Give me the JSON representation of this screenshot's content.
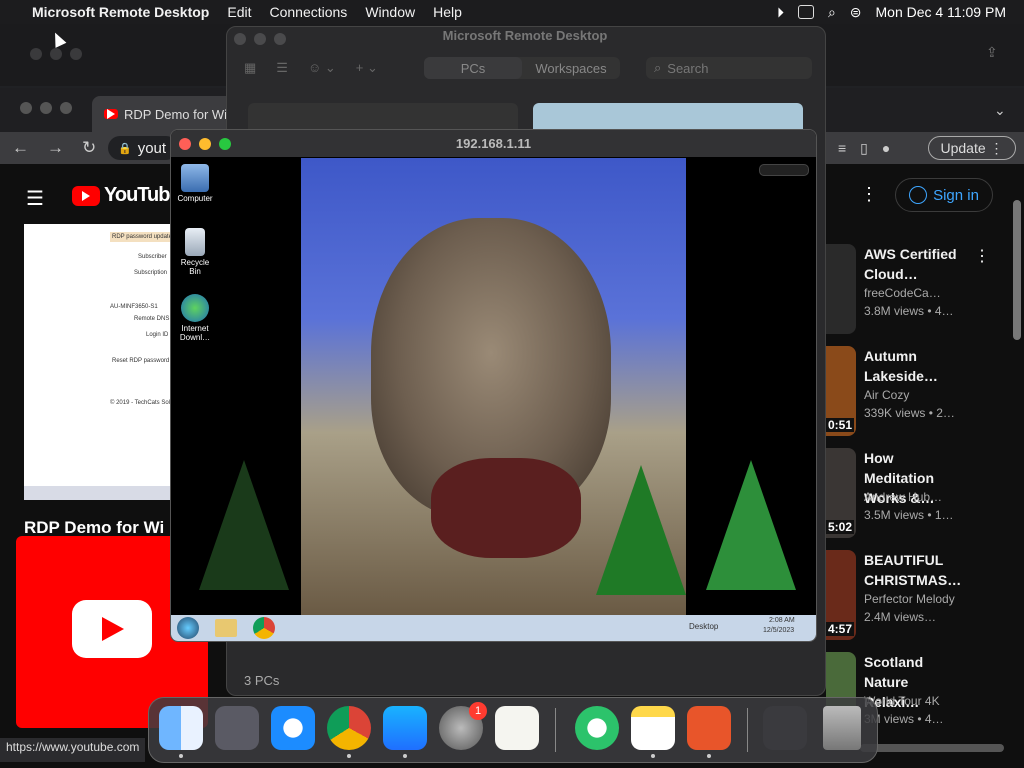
{
  "menubar": {
    "app": "Microsoft Remote Desktop",
    "menus": [
      "Edit",
      "Connections",
      "Window",
      "Help"
    ],
    "datetime": "Mon Dec 4  11:09 PM"
  },
  "chrome": {
    "tab_title": "RDP Demo for Wi",
    "url_fragment": "yout",
    "update_label": "Update",
    "status_url": "https://www.youtube.com"
  },
  "youtube": {
    "logo_text": "YouTube",
    "signin": "Sign in",
    "video_title": "RDP Demo for Wi",
    "thumb_lines": [
      "RDP password update",
      "Subscriber",
      "Subscription",
      "AU-MINF3650-S1",
      "Remote DNS",
      "Login ID",
      "Reset RDP password",
      "© 2019 - TechCats Sol"
    ],
    "suggestions": [
      {
        "title": "AWS Certified Cloud…",
        "channel": "freeCodeCa…",
        "views": "3.8M views  •  4…",
        "duration": ""
      },
      {
        "title": "Autumn Lakeside…",
        "channel": "Air Cozy",
        "views": "339K views  •  2…",
        "duration": "0:51"
      },
      {
        "title": "How Meditation Works &…",
        "channel": "Andrew Hub…",
        "views": "3.5M views  •  1…",
        "duration": "5:02"
      },
      {
        "title": "BEAUTIFUL CHRISTMAS…",
        "channel": "Perfector Melody",
        "views": "2.4M views…",
        "duration": "4:57"
      },
      {
        "title": "Scotland Nature Relaxi…",
        "channel": "World Tour 4K",
        "views": "3M views  •  4…",
        "duration": ""
      }
    ]
  },
  "mrd": {
    "title": "Microsoft Remote Desktop",
    "tabs": [
      "PCs",
      "Workspaces"
    ],
    "search_placeholder": "Search",
    "footer": "3 PCs"
  },
  "remote": {
    "title": "192.168.1.11",
    "desktop_icons": [
      "Computer",
      "Recycle Bin",
      "Internet Downl…"
    ],
    "taskbar_desktop": "Desktop",
    "taskbar_time": "2:08 AM",
    "taskbar_date": "12/5/2023"
  },
  "dock": {
    "badge": "1"
  },
  "colors": {
    "yt_red": "#ff0000",
    "signin_blue": "#3ea6ff",
    "close": "#ff5f57",
    "minimize": "#febc2e",
    "zoom": "#28c840"
  }
}
